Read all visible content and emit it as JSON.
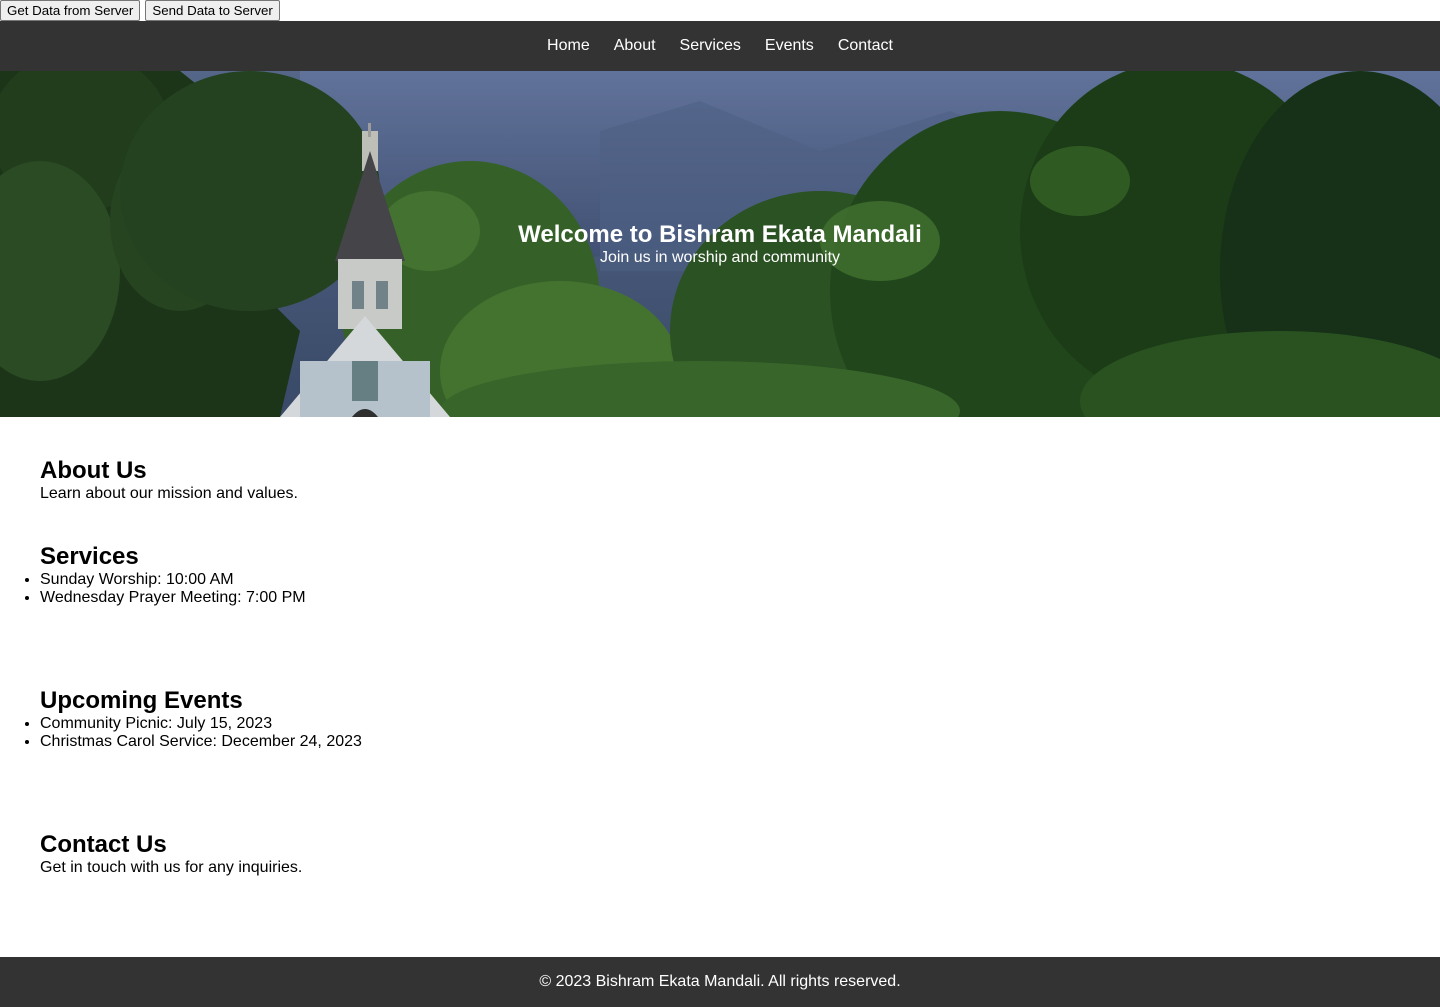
{
  "toolbar": {
    "get_label": "Get Data from Server",
    "send_label": "Send Data to Server"
  },
  "nav": {
    "items": [
      {
        "label": "Home"
      },
      {
        "label": "About"
      },
      {
        "label": "Services"
      },
      {
        "label": "Events"
      },
      {
        "label": "Contact"
      }
    ]
  },
  "hero": {
    "title": "Welcome to Bishram Ekata Mandali",
    "subtitle": "Join us in worship and community"
  },
  "about": {
    "heading": "About Us",
    "text": "Learn about our mission and values."
  },
  "services": {
    "heading": "Services",
    "items": [
      "Sunday Worship: 10:00 AM",
      "Wednesday Prayer Meeting: 7:00 PM"
    ]
  },
  "events": {
    "heading": "Upcoming Events",
    "items": [
      "Community Picnic: July 15, 2023",
      "Christmas Carol Service: December 24, 2023"
    ]
  },
  "contact": {
    "heading": "Contact Us",
    "text": "Get in touch with us for any inquiries."
  },
  "footer": {
    "text": "© 2023 Bishram Ekata Mandali. All rights reserved."
  },
  "colors": {
    "nav_bg": "#333333",
    "footer_bg": "#333333",
    "nav_text": "#ffffff"
  }
}
